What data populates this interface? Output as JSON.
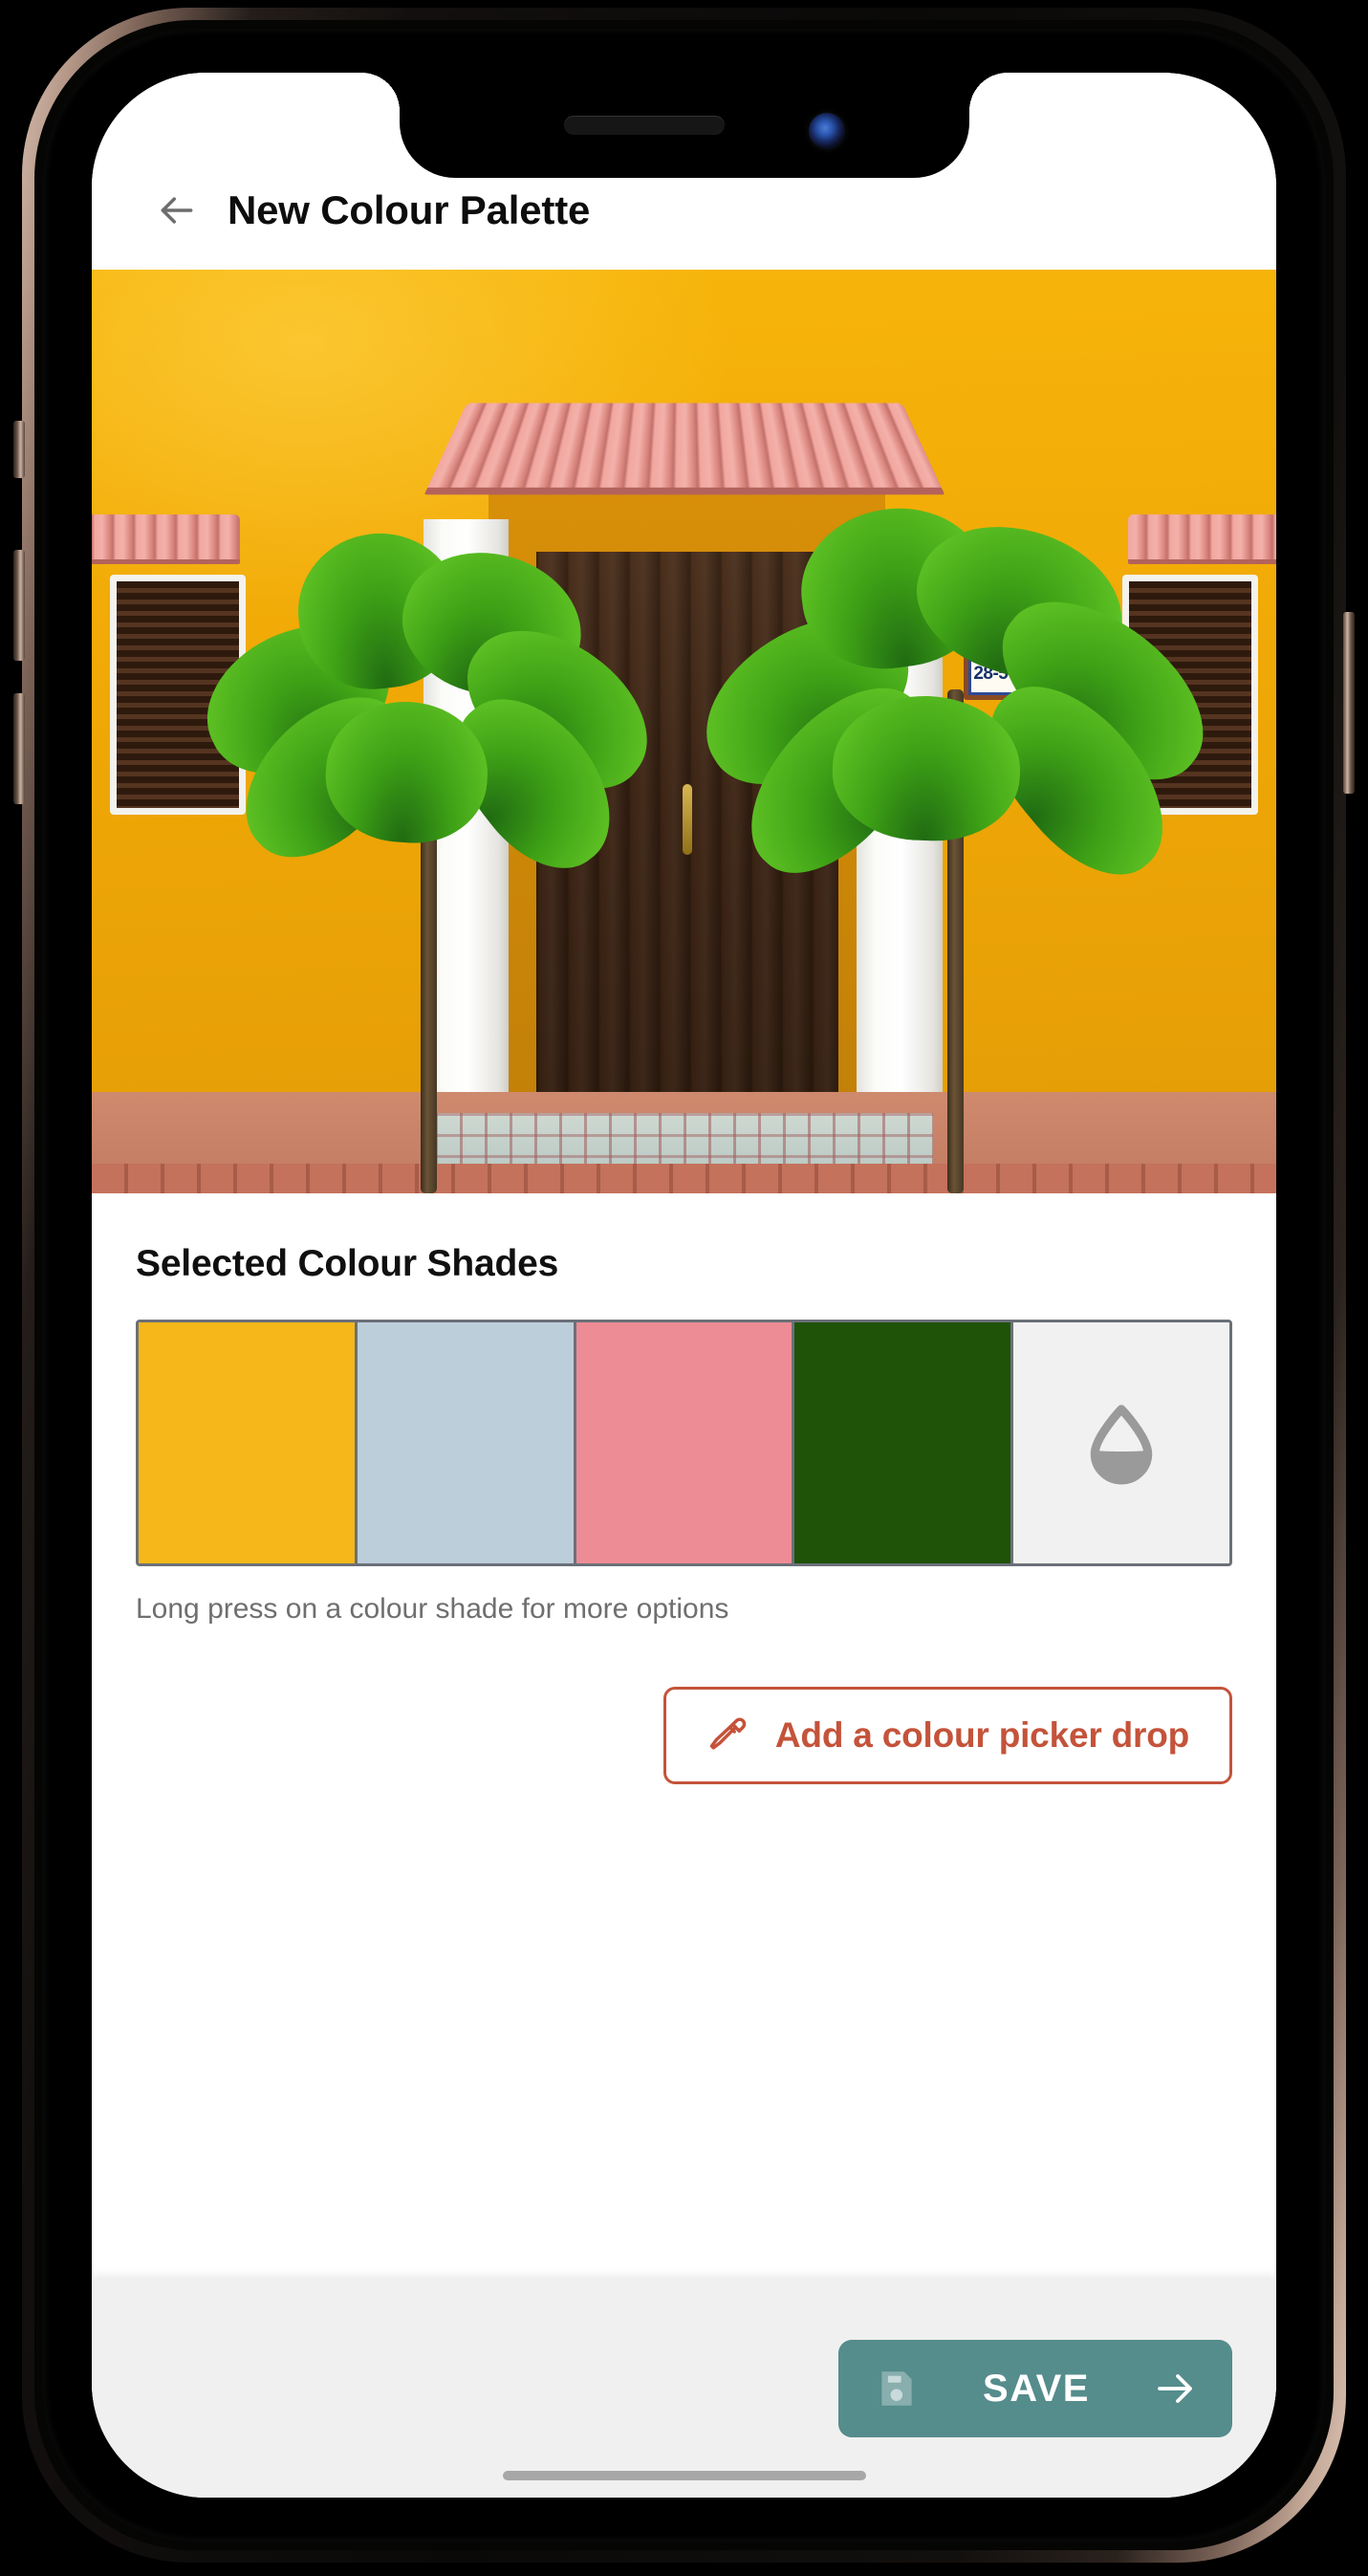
{
  "app": {
    "title": "New Colour Palette",
    "back_icon": "arrow-left-icon"
  },
  "photo": {
    "alt": "Yellow colonial building facade with palm trees and wooden door",
    "plaque_number": "28-50",
    "dominant_colors": {
      "wall_yellow": "#F0A806",
      "roof_pink": "#F2A7A0",
      "palm_green": "#3FA216",
      "door_brown": "#3C2414",
      "column_white": "#FFFFFF"
    }
  },
  "palette": {
    "section_title": "Selected Colour Shades",
    "hint": "Long press on a colour shade for more options",
    "swatches": [
      {
        "name": "swatch-yellow",
        "hex": "#F5B719"
      },
      {
        "name": "swatch-light-blue",
        "hex": "#BCCEDA"
      },
      {
        "name": "swatch-pink",
        "hex": "#EE8C96"
      },
      {
        "name": "swatch-dark-green",
        "hex": "#1E5308"
      }
    ],
    "add_slot": {
      "name": "add-drop-slot",
      "background": "#F1F1F1",
      "icon": "water-drop-icon",
      "icon_color": "#9A9A9A"
    },
    "border_color": "#6B7078"
  },
  "cta": {
    "label": "Add a colour picker drop",
    "icon": "eyedropper-icon",
    "color": "#C4533A"
  },
  "bottom_bar": {
    "background": "#F0F0F0",
    "save": {
      "label": "SAVE",
      "icon": "save-floppy-icon",
      "arrow_icon": "arrow-right-icon",
      "background": "#558C8C",
      "text_color": "#FFFFFF"
    }
  }
}
